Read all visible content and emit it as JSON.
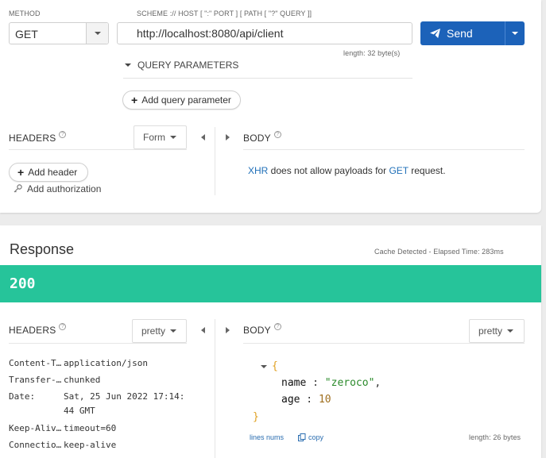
{
  "request": {
    "method_label": "METHOD",
    "method_value": "GET",
    "url_label": "SCHEME :// HOST [ \":\" PORT ] [ PATH [ \"?\" QUERY ]]",
    "url_value": "http://localhost:8080/api/client",
    "length_label": "length: 32 byte(s)",
    "send_label": "Send",
    "query_params_label": "QUERY PARAMETERS",
    "add_query_param_label": "Add query parameter",
    "headers_label": "HEADERS",
    "headers_mode": "Form",
    "add_header_label": "Add header",
    "add_authorization_label": "Add authorization",
    "body_label": "BODY",
    "body_message": {
      "xhr": "XHR",
      "middle": " does not allow payloads for ",
      "get": "GET",
      "end": " request."
    }
  },
  "response": {
    "title": "Response",
    "cache_info": "Cache Detected - Elapsed Time: 283ms",
    "status_code": "200",
    "status_color": "#26c49a",
    "headers_label": "HEADERS",
    "headers_mode": "pretty",
    "body_label": "BODY",
    "body_mode": "pretty",
    "headers": [
      {
        "key": "Content-T…",
        "value": "application/json"
      },
      {
        "key": "Transfer-…",
        "value": "chunked"
      },
      {
        "key": "Date:",
        "value": "Sat, 25 Jun 2022 17:14:",
        "value2": "44 GMT"
      },
      {
        "key": "Keep-Aliv…",
        "value": "timeout=60"
      },
      {
        "key": "Connectio…",
        "value": "keep-alive"
      }
    ],
    "json": {
      "open": "{",
      "close": "}",
      "fields": [
        {
          "key": "name",
          "sep": " :  ",
          "value": "\"zeroco\"",
          "comma": ","
        },
        {
          "key": "age",
          "sep": " :  ",
          "value": "10",
          "comma": ""
        }
      ]
    },
    "lines_nums_label": "lines nums",
    "copy_label": "copy",
    "body_length": "length: 26 bytes"
  },
  "colors": {
    "accent": "#1c62b9",
    "success": "#26c49a",
    "link": "#1f6fb8"
  }
}
